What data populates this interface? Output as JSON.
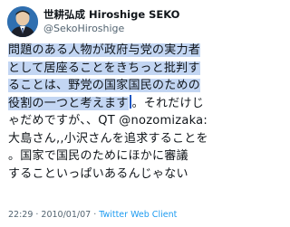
{
  "header": {
    "display_name": "世耕弘成 Hiroshige SEKO",
    "handle": "@SekoHiroshige"
  },
  "tweet": {
    "lines": [
      "問題のある人物が政府与党の実力者",
      "として居座ることをきちっと批判す",
      "ることは、野党の国家国民のための",
      "役割の一つと考えます",
      "。それだけじ",
      "ゃだめですが、、QT @nozomizaka:",
      "大島さん,,小沢さんを追求することを",
      "。国家で国民のためにほかに審議",
      "することいっぱいあるんじゃない"
    ]
  },
  "meta": {
    "time": "22:29",
    "separator": "·",
    "date": "2010/01/07",
    "client": "Twitter Web Client"
  },
  "colors": {
    "highlight": "#c3d6f3",
    "caret": "#1a56c4",
    "link": "#1d9bf0",
    "secondary_text": "#536471"
  }
}
